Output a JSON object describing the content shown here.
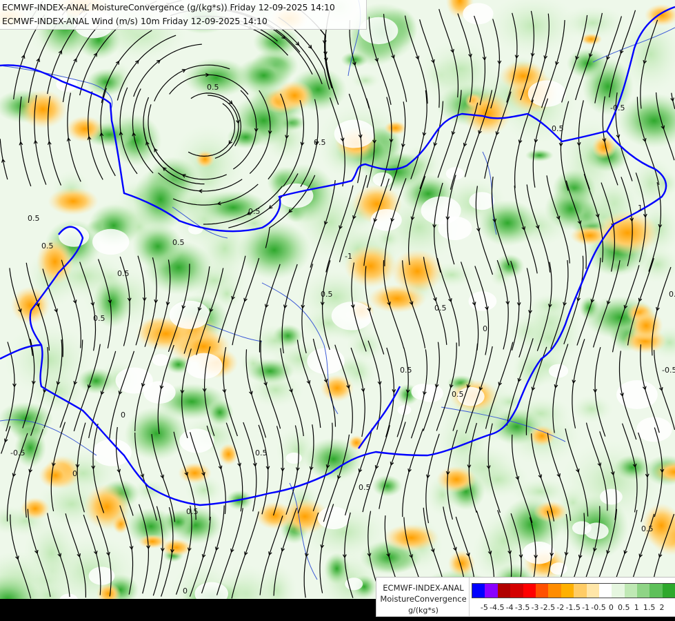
{
  "title": {
    "line1": "ECMWF-INDEX-ANAL MoistureConvergence (g/(kg*s)) Friday 12-09-2025 14:10",
    "line2": "ECMWF-INDEX-ANAL Wind (m/s) 10m Friday 12-09-2025 14:10"
  },
  "legend": {
    "line1": "ECMWF-INDEX-ANAL",
    "line2": "MoistureConvergence",
    "unit": "g/(kg*s)",
    "colors": [
      "#0000ff",
      "#8a00ff",
      "#b00000",
      "#d40000",
      "#ff0000",
      "#ff5000",
      "#ff8c00",
      "#ffb000",
      "#ffcc66",
      "#ffe6a8",
      "#ffffff",
      "#e6f6e0",
      "#bfe8b4",
      "#8fd486",
      "#5ec05a",
      "#2ea82c",
      "#0a8f10"
    ],
    "ticks": [
      "-5",
      "-4.5",
      "-4",
      "-3.5",
      "-3",
      "-2.5",
      "-2",
      "-1.5",
      "-1",
      "-0.5",
      "0",
      "0.5",
      "1",
      "1.5",
      "2"
    ]
  },
  "map": {
    "border_color": "#0000ff",
    "river_color": "#3c5ad6",
    "streamline_color": "#000000",
    "positive_color": "#8fd486",
    "negative_color": "#ffcc66",
    "contour_labels": [
      "0.5",
      "0.5",
      "0.5",
      "0.5",
      "0.5",
      "0.5",
      "0.5",
      "0.5",
      "0.5",
      "0.5",
      "0.5",
      "0.5",
      "0.5",
      "0.5",
      "0.5",
      "0.5",
      "0.5",
      "0.5",
      "-0.5",
      "-0.5",
      "-0.5",
      "-1",
      "0",
      "0",
      "0",
      "0",
      "1"
    ]
  }
}
